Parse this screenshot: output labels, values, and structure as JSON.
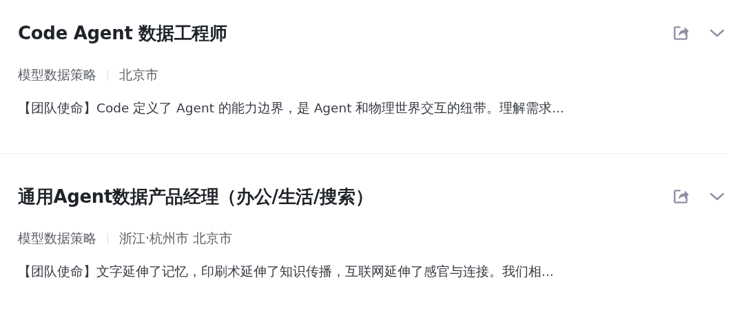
{
  "jobs": [
    {
      "title": "Code Agent 数据工程师",
      "department": "模型数据策略",
      "location": "北京市",
      "description": "【团队使命】Code 定义了 Agent 的能力边界，是 Agent 和物理世界交互的纽带。理解需求..."
    },
    {
      "title": "通用Agent数据产品经理（办公/生活/搜索）",
      "department": "模型数据策略",
      "location": "浙江·杭州市 北京市",
      "description": "【团队使命】文字延伸了记忆，印刷术延伸了知识传播，互联网延伸了感官与连接。我们相..."
    }
  ]
}
